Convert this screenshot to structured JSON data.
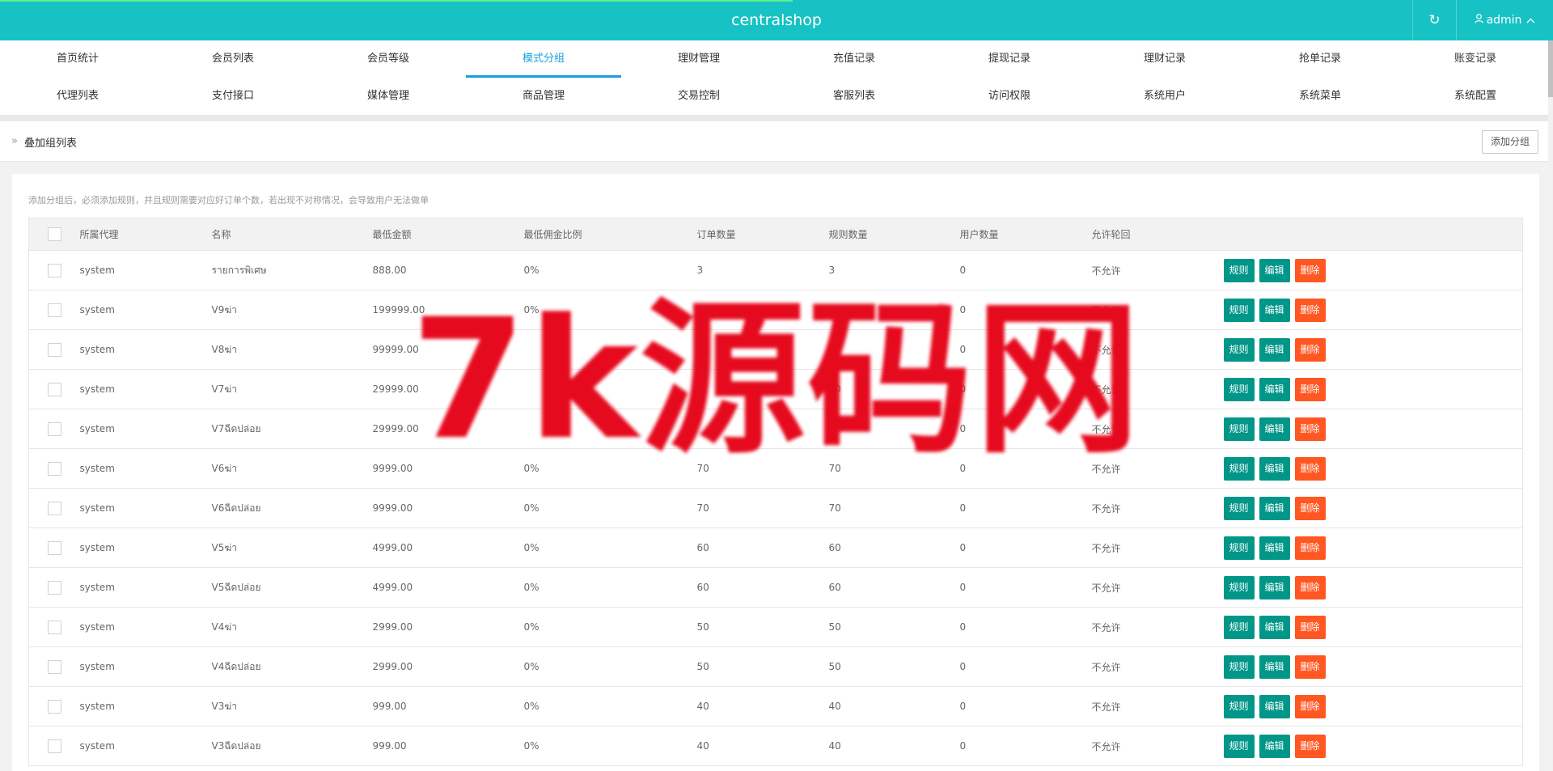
{
  "header": {
    "brand": "centralshop",
    "refresh_icon": "↻",
    "user_label": "admin",
    "user_icon": "user-icon",
    "accent_color": "#17c2c4"
  },
  "nav": {
    "row1": [
      "首页统计",
      "会员列表",
      "会员等级",
      "模式分组",
      "理财管理",
      "充值记录",
      "提现记录",
      "理财记录",
      "抢单记录",
      "账变记录"
    ],
    "row2": [
      "代理列表",
      "支付接口",
      "媒体管理",
      "商品管理",
      "交易控制",
      "客服列表",
      "访问权限",
      "系统用户",
      "系统菜单",
      "系统配置"
    ],
    "active": "模式分组"
  },
  "breadcrumb": {
    "title": "叠加组列表",
    "add_button": "添加分组"
  },
  "tip": "添加分组后，必须添加规则，并且规则需要对应好订单个数，若出现不对称情况，会导致用户无法做单",
  "table": {
    "headers": [
      "所属代理",
      "名称",
      "最低金额",
      "最低佣金比例",
      "订单数量",
      "规则数量",
      "用户数量",
      "允许轮回"
    ],
    "actions": [
      "规则",
      "编辑",
      "删除"
    ],
    "rows": [
      [
        "system",
        "รายการพิเศษ",
        "888.00",
        "0%",
        "3",
        "3",
        "0",
        "不允许"
      ],
      [
        "system",
        "V9ฆ่า",
        "199999.00",
        "0%",
        "",
        "",
        "0",
        "不允许"
      ],
      [
        "system",
        "V8ฆ่า",
        "99999.00",
        "",
        "",
        "",
        "0",
        "不允许"
      ],
      [
        "system",
        "V7ฆ่า",
        "29999.00",
        "",
        "",
        "80",
        "0",
        "不允许"
      ],
      [
        "system",
        "V7ฉีดปล่อย",
        "29999.00",
        "",
        "",
        "",
        "0",
        "不允许"
      ],
      [
        "system",
        "V6ฆ่า",
        "9999.00",
        "0%",
        "70",
        "70",
        "0",
        "不允许"
      ],
      [
        "system",
        "V6ฉีดปล่อย",
        "9999.00",
        "0%",
        "70",
        "70",
        "0",
        "不允许"
      ],
      [
        "system",
        "V5ฆ่า",
        "4999.00",
        "0%",
        "60",
        "60",
        "0",
        "不允许"
      ],
      [
        "system",
        "V5ฉีดปล่อย",
        "4999.00",
        "0%",
        "60",
        "60",
        "0",
        "不允许"
      ],
      [
        "system",
        "V4ฆ่า",
        "2999.00",
        "0%",
        "50",
        "50",
        "0",
        "不允许"
      ],
      [
        "system",
        "V4ฉีดปล่อย",
        "2999.00",
        "0%",
        "50",
        "50",
        "0",
        "不允许"
      ],
      [
        "system",
        "V3ฆ่า",
        "999.00",
        "0%",
        "40",
        "40",
        "0",
        "不允许"
      ],
      [
        "system",
        "V3ฉีดปล่อย",
        "999.00",
        "0%",
        "40",
        "40",
        "0",
        "不允许"
      ]
    ]
  },
  "watermark": "7k源码网"
}
